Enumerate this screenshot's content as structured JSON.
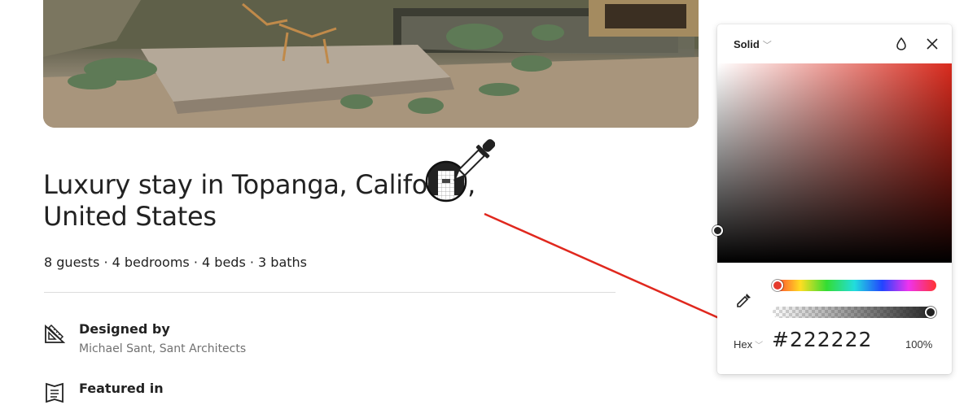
{
  "listing": {
    "title_line1": "Luxury stay in Topanga, Califo",
    "title_line1_end": ",",
    "title_line2": "United States",
    "stats": "8 guests · 4 bedrooms · 4 beds · 3 baths",
    "details": [
      {
        "heading": "Designed by",
        "subtext": "Michael Sant, Sant Architects",
        "icon": "drafting-tools-icon"
      },
      {
        "heading": "Featured in",
        "subtext": "",
        "icon": "magazine-icon"
      }
    ]
  },
  "color_picker": {
    "fill_type": "Solid",
    "format": "Hex",
    "hex_value": "#222222",
    "opacity": "100%",
    "hue": 4,
    "opacity_fraction": 1.0,
    "selected_color": "#222222",
    "base_hue_color": "#d82a1d",
    "icons": [
      "chevron-down-icon",
      "droplet-icon",
      "close-icon",
      "eyedropper-icon"
    ]
  },
  "annotation": {
    "arrow_color": "#e0281e"
  }
}
